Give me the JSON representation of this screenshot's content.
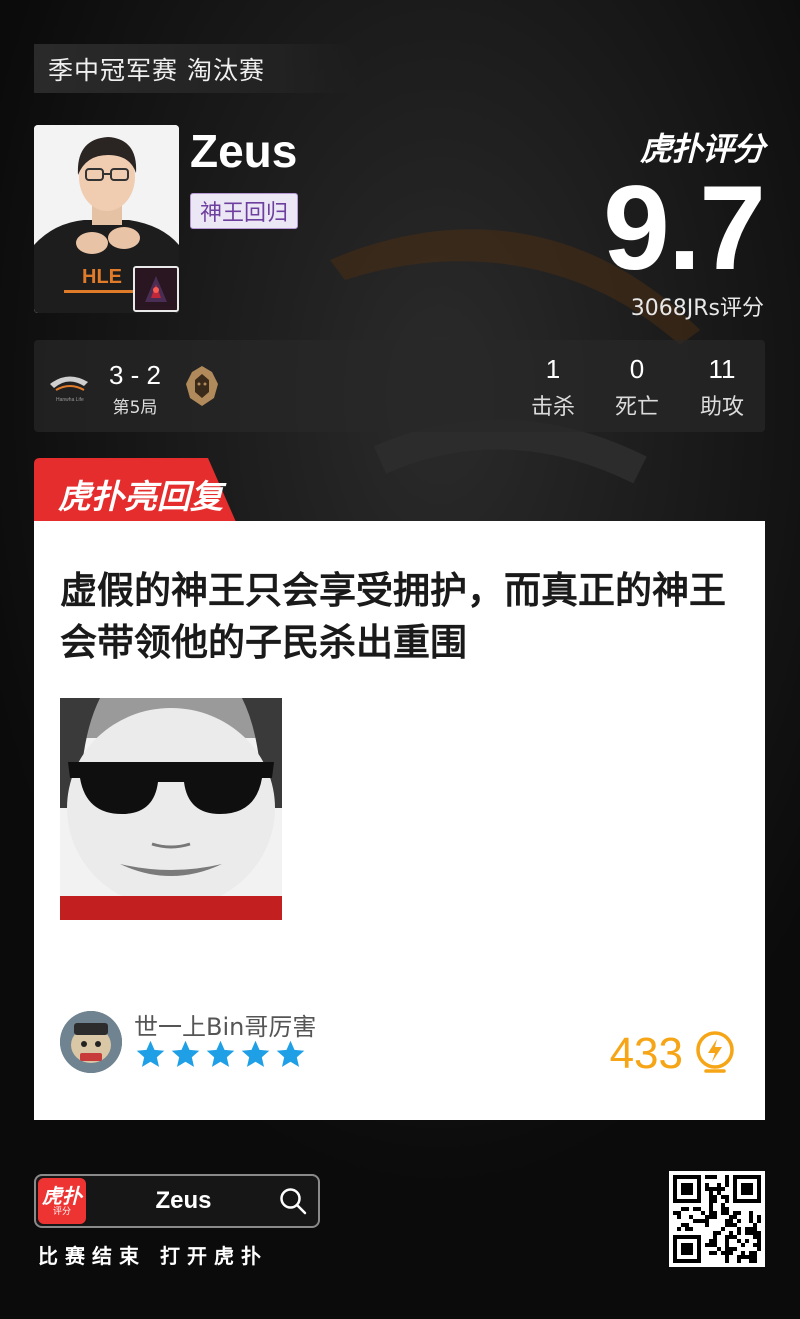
{
  "event": {
    "title": "季中冠军赛 淘汰赛"
  },
  "player": {
    "name": "Zeus",
    "tag": "神王回归"
  },
  "rating": {
    "brand": "虎扑评分",
    "score": "9.7",
    "count": "3068JRs评分"
  },
  "match": {
    "series_score": "3 - 2",
    "game_label": "第5局",
    "stats": [
      {
        "value": "1",
        "label": "击杀"
      },
      {
        "value": "0",
        "label": "死亡"
      },
      {
        "value": "11",
        "label": "助攻"
      }
    ]
  },
  "hot_reply": {
    "tab_label": "虎扑亮回复",
    "text": "虚假的神王只会享受拥护，而真正的神王会带领他的子民杀出重围",
    "username": "世一上Bin哥厉害",
    "stars": 5,
    "likes": "433"
  },
  "app_bar": {
    "logo_text": "虎扑",
    "logo_sub": "评分",
    "search_query": "Zeus",
    "caption": "比赛结束 打开虎扑"
  },
  "colors": {
    "accent_red": "#e52d2d",
    "tag_purple": "#6d3f9e",
    "like_orange": "#f5a516",
    "star_blue": "#1e9fe6"
  }
}
